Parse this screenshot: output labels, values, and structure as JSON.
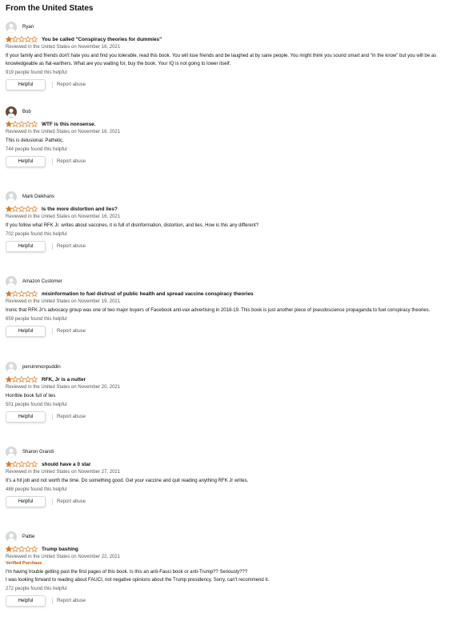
{
  "section_title": "From the United States",
  "helpful_label": "Helpful",
  "report_label": "Report abuse",
  "reviews": [
    {
      "name": "Ryan",
      "rating": 1,
      "title": "You be called \"Conspiracy theories for dummies\"",
      "date": "Reviewed in the United States on November 16, 2021",
      "verified": "",
      "body": "If your family and friends don't hate you and find you tolerable, read this book. You will lose friends and be laughed at by sane people. You might think you sound smart and \"in the know\" but you will be as knowledgeable as flat-earthers. What are you waiting for, buy the book. Your IQ is not going to lower itself.",
      "helpful_count": "919 people found this helpful"
    },
    {
      "name": "Bob",
      "rating": 1,
      "title": "WTF is this nonsense.",
      "date": "Reviewed in the United States on November 16, 2021",
      "verified": "",
      "body": "This is delusional. Pathetic.",
      "helpful_count": "744 people found this helpful"
    },
    {
      "name": "Mark Diekhans",
      "rating": 1,
      "title": "Is the more distortion and lies?",
      "date": "Reviewed in the United States on November 16, 2021",
      "verified": "",
      "body": "If you follow what RFK Jr. writes about vaccines, it is full of disinformation, distortion, and lies. How is this any different?",
      "helpful_count": "702 people found this helpful"
    },
    {
      "name": "Amazon Customer",
      "rating": 1,
      "title": "misinformation to fuel distrust of public health and spread vaccine conspiracy theories",
      "date": "Reviewed in the United States on November 19, 2021",
      "verified": "",
      "body": "Ironic that RFK Jr's advocacy group was one of two major buyers of Facebook anti-vax advertising in 2018-19. This book is just another piece of pseudoscience propaganda to fuel conspiracy theories.",
      "helpful_count": "659 people found this helpful"
    },
    {
      "name": "persimmonpuddin",
      "rating": 1,
      "title": "RFK, Jr is a nutter",
      "date": "Reviewed in the United States on November 20, 2021",
      "verified": "",
      "body": "Horrible book full of lies",
      "helpful_count": "501 people found this helpful"
    },
    {
      "name": "Sharon Grandi",
      "rating": 1,
      "title": "should have a 0 star",
      "date": "Reviewed in the United States on November 27, 2021",
      "verified": "",
      "body": "It's a hit job and not worth the time. Do something good. Get your vaccine and quit reading anything RFK Jr writes.",
      "helpful_count": "488 people found this helpful"
    },
    {
      "name": "Pattie",
      "rating": 1,
      "title": "Trump bashing",
      "date": "Reviewed in the United States on November 22, 2021",
      "verified": "Verified Purchase",
      "body": "I'm having trouble getting past the first pages of this book. Is this an anti-Fauci book or anti-Trump?? Seriously???\nI was looking forward to reading about FAUCI, not negative opinions about the Trump presidency. Sorry, can't recommend it.",
      "helpful_count": "272 people found this helpful"
    }
  ],
  "colors": {
    "star": "#de7921",
    "verified": "#c45500",
    "muted": "#565959",
    "text": "#0f1111"
  },
  "icons": {
    "avatar": "default-profile-icon",
    "star_filled": "star-filled-icon",
    "star_empty": "star-empty-icon"
  }
}
